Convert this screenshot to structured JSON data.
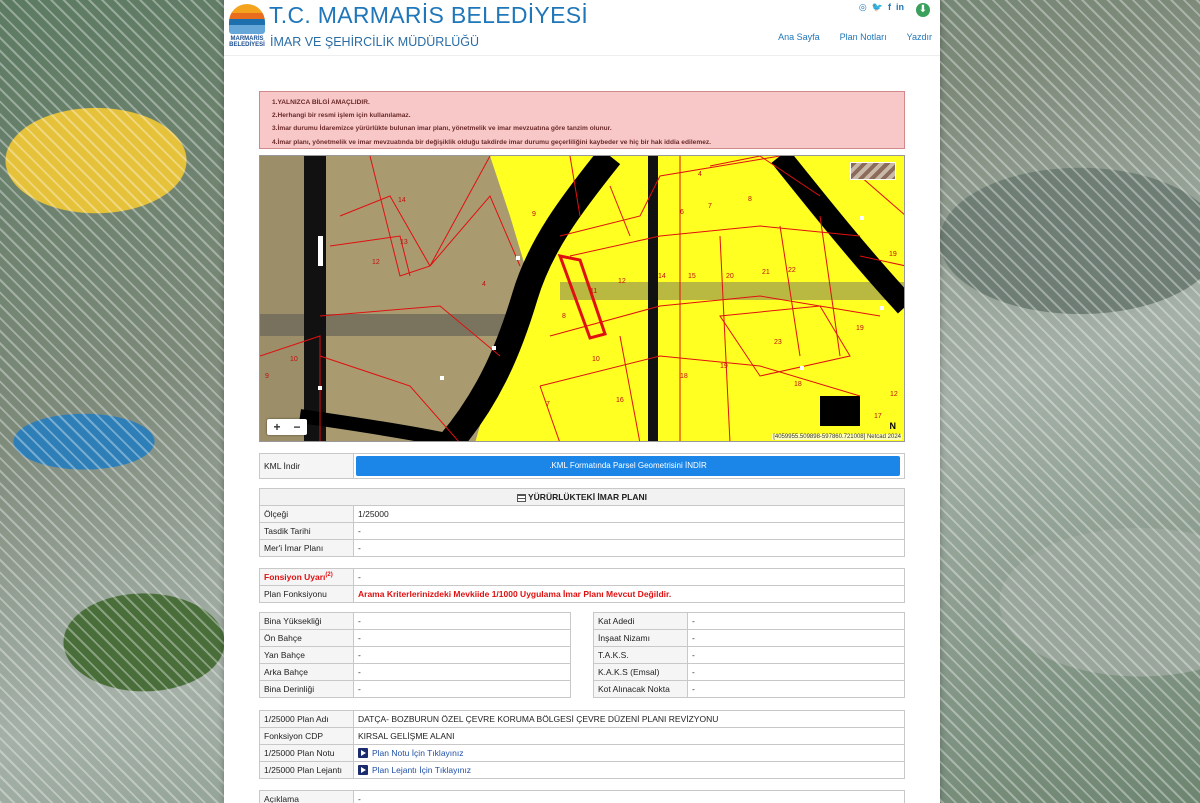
{
  "header": {
    "logo_text": "MARMARİS BELEDİYESİ",
    "title": "T.C. MARMARİS BELEDİYESİ",
    "subtitle": "İMAR VE ŞEHİRCİLİK MÜDÜRLÜĞÜ",
    "social_icons": [
      "instagram-icon",
      "twitter-icon",
      "facebook-icon",
      "linkedin-icon"
    ],
    "nav": [
      "Ana Sayfa",
      "Plan Notları",
      "Yazdır"
    ]
  },
  "warning": {
    "lines": [
      "1.YALNIZCA BİLGİ AMAÇLIDIR.",
      "2.Herhangi bir resmi işlem için kullanılamaz.",
      "3.İmar durumu İdaremizce yürürlükte bulunan imar planı, yönetmelik ve imar mevzuatına göre tanzim olunur.",
      "4.İmar planı, yönetmelik ve imar mevzuatında bir değişiklik olduğu takdirde imar durumu geçerliliğini kaybeder ve hiç bir hak iddia edilemez."
    ]
  },
  "map": {
    "zoom_in": "+",
    "zoom_out": "−",
    "coords": "[4059955.509898-597860.721008] Netcad 2024",
    "north": "N",
    "parcel_labels": [
      "14",
      "13",
      "12",
      "4",
      "9",
      "10",
      "8",
      "9",
      "7",
      "16",
      "10",
      "12",
      "11",
      "14",
      "15",
      "20",
      "21",
      "22",
      "6",
      "7",
      "8",
      "4",
      "23",
      "19",
      "18",
      "19",
      "18",
      "17",
      "19",
      "12"
    ]
  },
  "kml": {
    "label": "KML İndir",
    "button": ".KML Formatında Parsel Geometrisini İNDİR"
  },
  "plan": {
    "header": "YÜRÜRLÜKTEKİ İMAR PLANI",
    "rows": [
      {
        "label": "Ölçeği",
        "value": "1/25000"
      },
      {
        "label": "Tasdik Tarihi",
        "value": "-"
      },
      {
        "label": "Mer'i İmar Planı",
        "value": "-"
      }
    ]
  },
  "function": {
    "warning_label": "Fonsiyon Uyarı",
    "warning_sup": "(2)",
    "warning_value": "-",
    "plan_label": "Plan Fonksiyonu",
    "plan_value": "Arama Kriterlerinizdeki Mevkiide 1/1000 Uygulama İmar Planı Mevcut Değildir."
  },
  "building_left": [
    {
      "label": "Bina Yüksekliği",
      "value": "-"
    },
    {
      "label": "Ön Bahçe",
      "value": "-"
    },
    {
      "label": "Yan Bahçe",
      "value": "-"
    },
    {
      "label": "Arka Bahçe",
      "value": "-"
    },
    {
      "label": "Bina Derinliği",
      "value": "-"
    }
  ],
  "building_right": [
    {
      "label": "Kat Adedi",
      "value": "-"
    },
    {
      "label": "İnşaat Nizamı",
      "value": "-"
    },
    {
      "label": "T.A.K.S.",
      "value": "-"
    },
    {
      "label": "K.A.K.S (Emsal)",
      "value": "-"
    },
    {
      "label": "Kot Alınacak Nokta",
      "value": "-"
    }
  ],
  "plan25000": {
    "name_label": "1/25000 Plan Adı",
    "name_value": "DATÇA- BOZBURUN ÖZEL ÇEVRE KORUMA BÖLGESİ ÇEVRE DÜZENİ PLANI REVİZYONU",
    "cdp_label": "Fonksiyon CDP",
    "cdp_value": "KIRSAL GELİŞME ALANI",
    "note_label": "1/25000 Plan Notu",
    "note_link": "Plan Notu İçin Tıklayınız",
    "legend_label": "1/25000 Plan Lejantı",
    "legend_link": "Plan Lejantı İçin Tıklayınız"
  },
  "description": {
    "label": "Açıklama",
    "value": "-"
  }
}
